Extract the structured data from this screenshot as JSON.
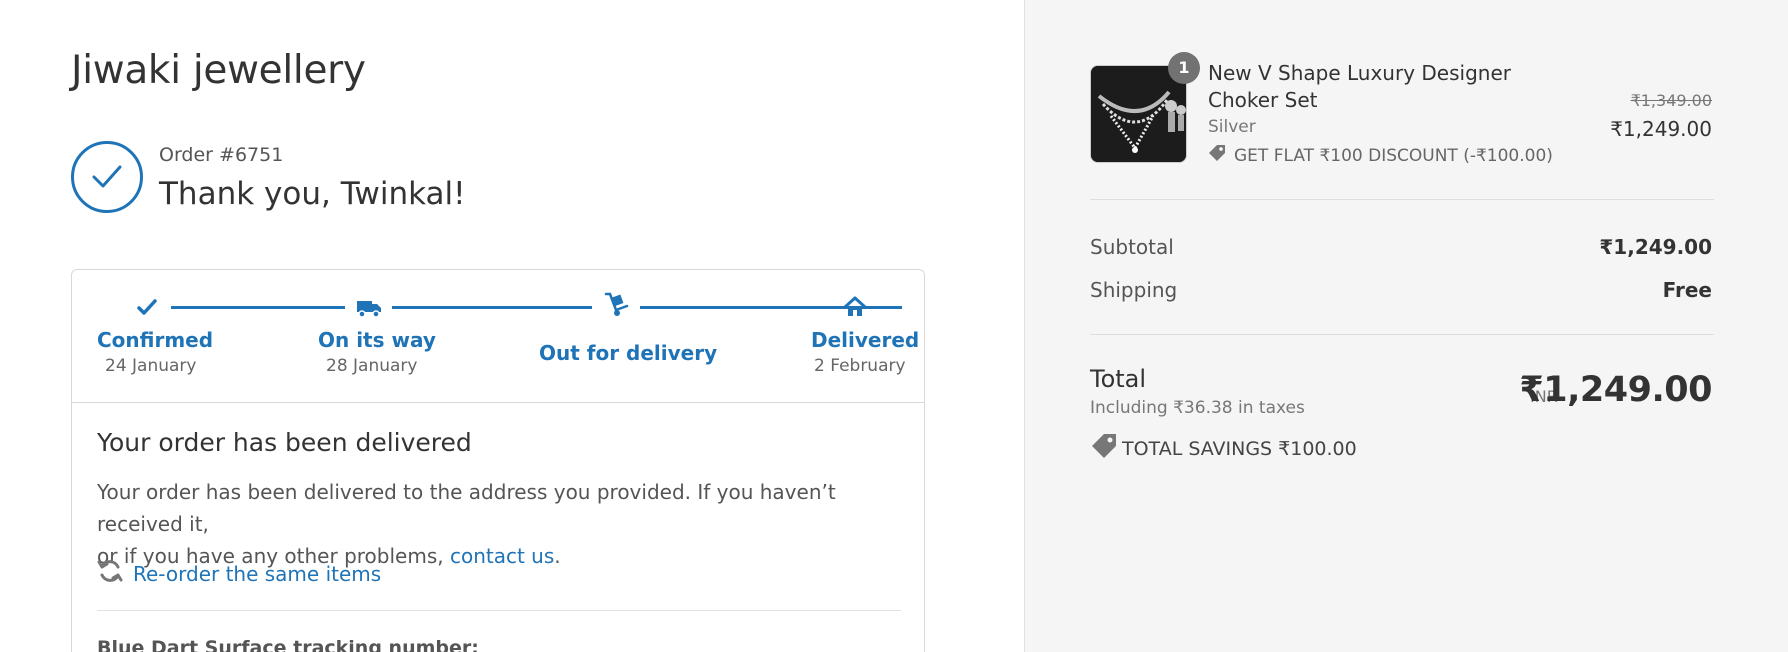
{
  "shop": {
    "name": "Jiwaki jewellery"
  },
  "order": {
    "number": "Order #6751",
    "thanks": "Thank you, Twinkal!"
  },
  "timeline": {
    "steps": [
      {
        "label": "Confirmed",
        "date": "24 January",
        "icon": "check-icon"
      },
      {
        "label": "On its way",
        "date": "28 January",
        "icon": "truck-icon"
      },
      {
        "label": "Out for delivery",
        "date": "",
        "icon": "hand-truck-icon"
      },
      {
        "label": "Delivered",
        "date": "2 February",
        "icon": "home-icon"
      }
    ]
  },
  "status": {
    "title": "Your order has been delivered",
    "body_line1": "Your order has been delivered to the address you provided. If you haven’t received it,",
    "body_line2_prefix": "or if you have any other problems, ",
    "contact_link": "contact us",
    "body_line2_suffix": ".",
    "reorder_label": "Re-order the same items",
    "tracking_label": "Blue Dart Surface tracking number:"
  },
  "summary": {
    "item": {
      "quantity": "1",
      "name": "New V Shape Luxury Designer Choker Set",
      "variant": "Silver",
      "discount": "GET FLAT ₹100 DISCOUNT (-₹100.00)",
      "price_original": "₹1,349.00",
      "price_final": "₹1,249.00"
    },
    "subtotal_label": "Subtotal",
    "subtotal_value": "₹1,249.00",
    "shipping_label": "Shipping",
    "shipping_value": "Free",
    "total_label": "Total",
    "tax_note": "Including ₹36.38 in taxes",
    "currency": "INR",
    "total_value": "₹1,249.00",
    "savings": "TOTAL SAVINGS ₹100.00"
  },
  "colors": {
    "accent": "#1f73b7",
    "sidebar_bg": "#f5f5f5"
  }
}
